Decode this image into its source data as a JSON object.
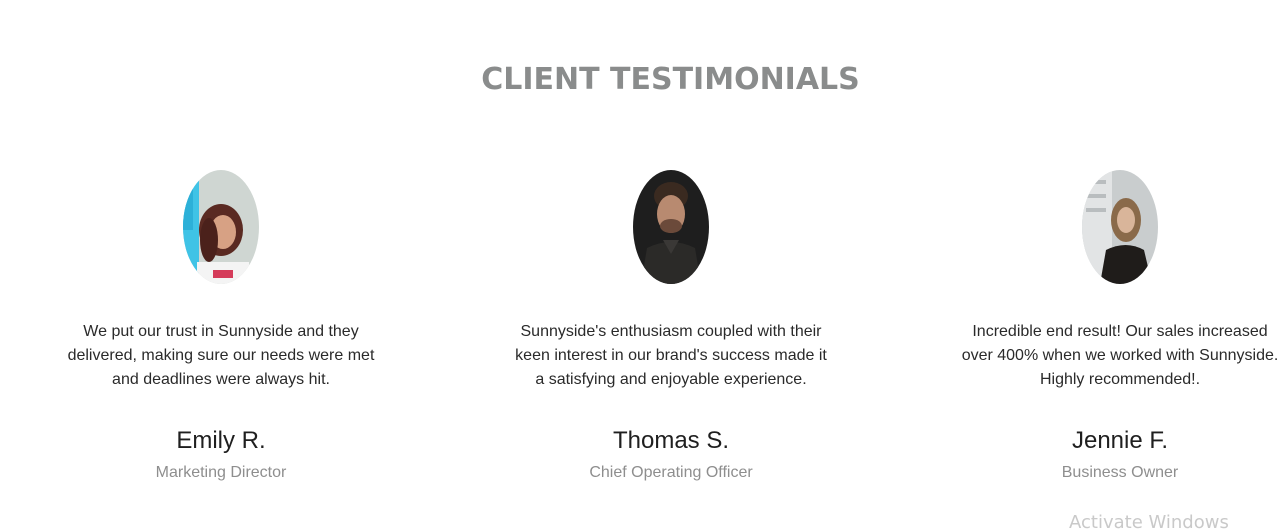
{
  "section": {
    "title": "CLIENT TESTIMONIALS"
  },
  "testimonials": [
    {
      "avatar_icon": "woman-portrait-photo",
      "quote_lines": [
        "We put our trust in Sunnyside and they",
        "delivered, making sure our needs were met",
        "and deadlines were always hit."
      ],
      "name": "Emily R.",
      "role": "Marketing Director"
    },
    {
      "avatar_icon": "man-portrait-photo",
      "quote_lines": [
        "Sunnyside's enthusiasm coupled with their",
        "keen interest in our brand's success made it",
        "a satisfying and enjoyable experience."
      ],
      "name": "Thomas S.",
      "role": "Chief Operating Officer"
    },
    {
      "avatar_icon": "woman-portrait-photo",
      "quote_lines": [
        "Incredible end result! Our sales increased",
        "over 400% when we worked with Sunnyside.",
        "Highly recommended!."
      ],
      "name": "Jennie F.",
      "role": "Business Owner"
    }
  ],
  "watermark": {
    "text": "Activate Windows"
  },
  "colors": {
    "title": "#8a8c8c",
    "quote": "#2a2a2a",
    "name": "#1f1f1f",
    "role": "#8e8e8e"
  }
}
